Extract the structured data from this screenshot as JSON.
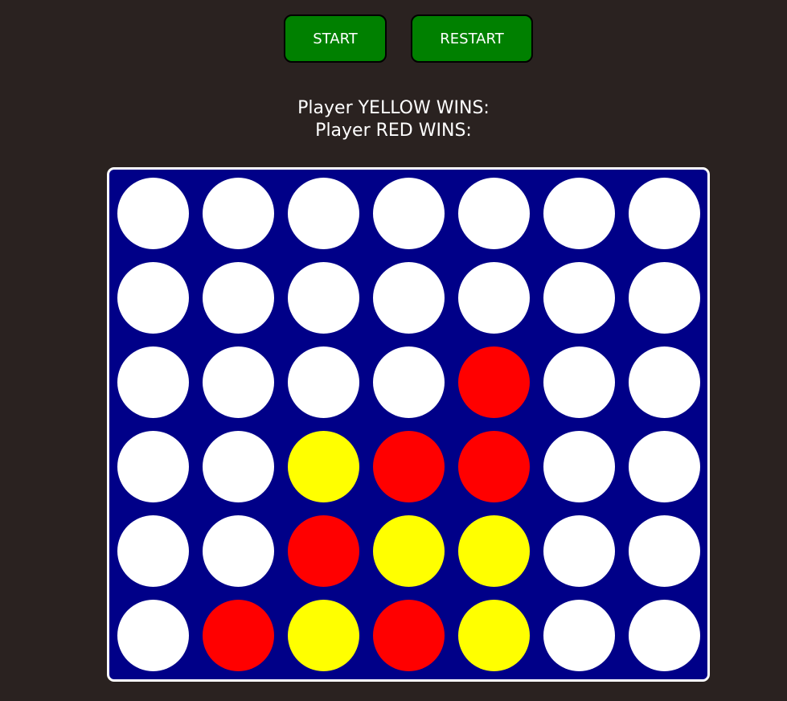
{
  "controls": {
    "start_label": "START",
    "restart_label": "RESTART"
  },
  "scores": {
    "yellow_label": "Player YELLOW WINS:",
    "red_label": "Player RED WINS:"
  },
  "colors": {
    "empty": "#ffffff",
    "yellow": "#ffff00",
    "red": "#ff0000",
    "board": "#000088",
    "button": "#008000",
    "background": "#2a2220"
  },
  "board": {
    "rows": 6,
    "columns": 7,
    "grid": [
      [
        "empty",
        "empty",
        "empty",
        "empty",
        "empty",
        "empty",
        "empty"
      ],
      [
        "empty",
        "empty",
        "empty",
        "empty",
        "empty",
        "empty",
        "empty"
      ],
      [
        "empty",
        "empty",
        "empty",
        "empty",
        "red",
        "empty",
        "empty"
      ],
      [
        "empty",
        "empty",
        "yellow",
        "red",
        "red",
        "empty",
        "empty"
      ],
      [
        "empty",
        "empty",
        "red",
        "yellow",
        "yellow",
        "empty",
        "empty"
      ],
      [
        "empty",
        "red",
        "yellow",
        "red",
        "yellow",
        "empty",
        "empty"
      ]
    ]
  }
}
